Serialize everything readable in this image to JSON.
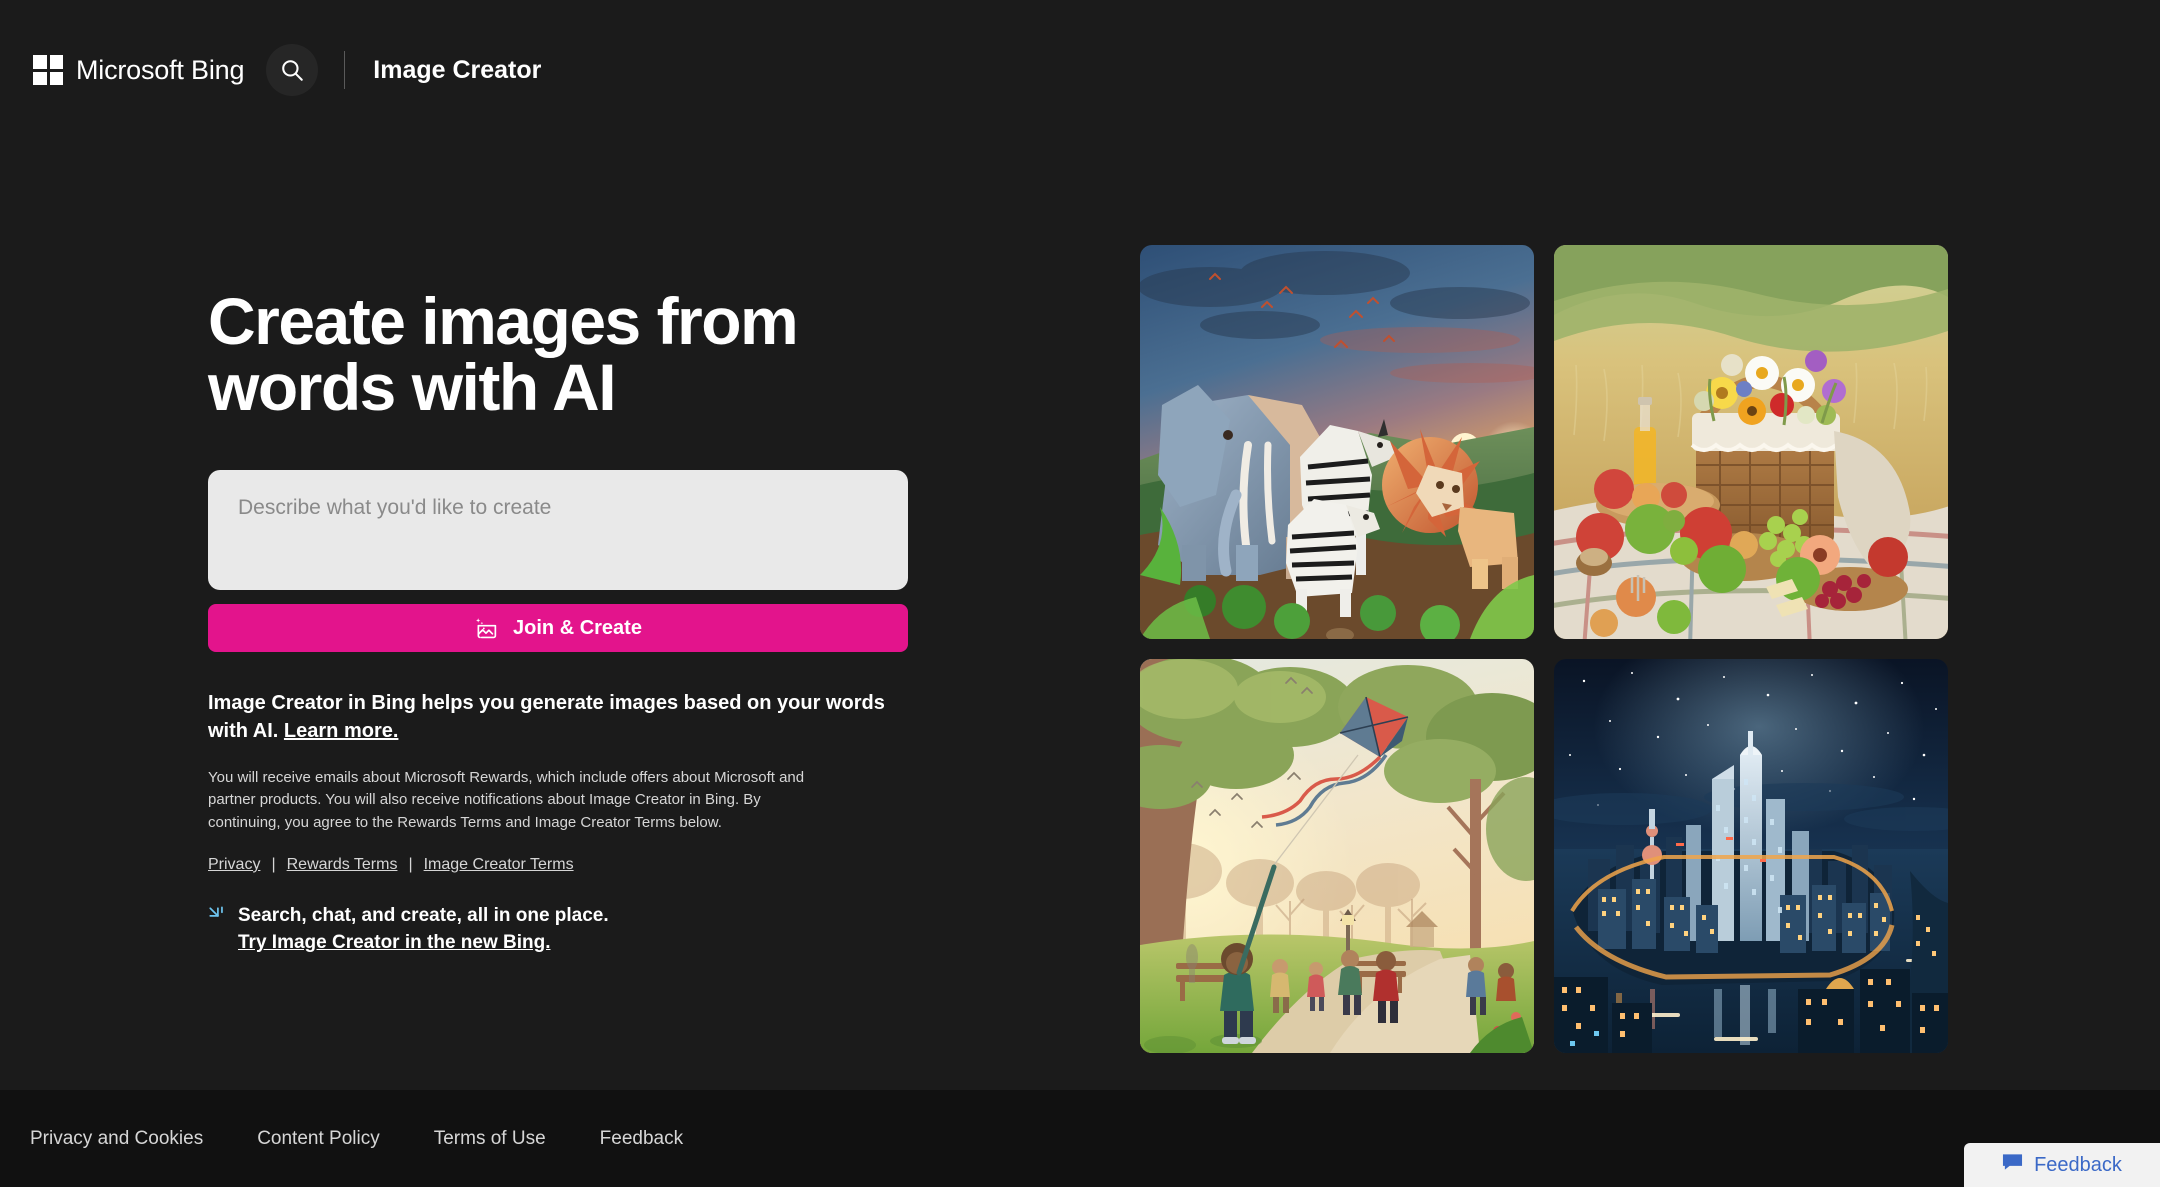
{
  "header": {
    "brand": "Microsoft Bing",
    "search_icon": "search-icon",
    "logo_icon": "microsoft-logo-icon",
    "product_title": "Image Creator"
  },
  "hero": {
    "title": "Create images from words with AI"
  },
  "prompt": {
    "placeholder": "Describe what you'd like to create",
    "value": ""
  },
  "cta": {
    "label": "Join & Create",
    "icon": "image-sparkle-icon",
    "color": "#e3148c"
  },
  "description": {
    "lead": "Image Creator in Bing helps you generate images based on your words with AI. ",
    "learn_more": "Learn more.",
    "legal": "You will receive emails about Microsoft Rewards, which include offers about Microsoft and partner products. You will also receive notifications about Image Creator in Bing. By continuing, you agree to the Rewards Terms and Image Creator Terms below."
  },
  "terms_links": [
    {
      "label": "Privacy"
    },
    {
      "label": "Rewards Terms"
    },
    {
      "label": "Image Creator Terms"
    }
  ],
  "terms_separator": "|",
  "promo": {
    "icon": "bing-sparkle-icon",
    "icon_color": "#6ec5f0",
    "headline": "Search, chat, and create, all in one place.",
    "link": "Try Image Creator in the new Bing."
  },
  "gallery": [
    {
      "alt": "origami safari animals at sunset",
      "name": "gallery-image-1"
    },
    {
      "alt": "picnic basket with wildflowers and fruit in a meadow",
      "name": "gallery-image-2"
    },
    {
      "alt": "child flying a kite in a sunlit park",
      "name": "gallery-image-3"
    },
    {
      "alt": "night cityscape with skyscrapers and river",
      "name": "gallery-image-4"
    }
  ],
  "footer": {
    "links": [
      {
        "label": "Privacy and Cookies"
      },
      {
        "label": "Content Policy"
      },
      {
        "label": "Terms of Use"
      },
      {
        "label": "Feedback"
      }
    ]
  },
  "feedback_widget": {
    "label": "Feedback",
    "icon": "speech-bubble-icon",
    "color": "#3b69c7"
  }
}
